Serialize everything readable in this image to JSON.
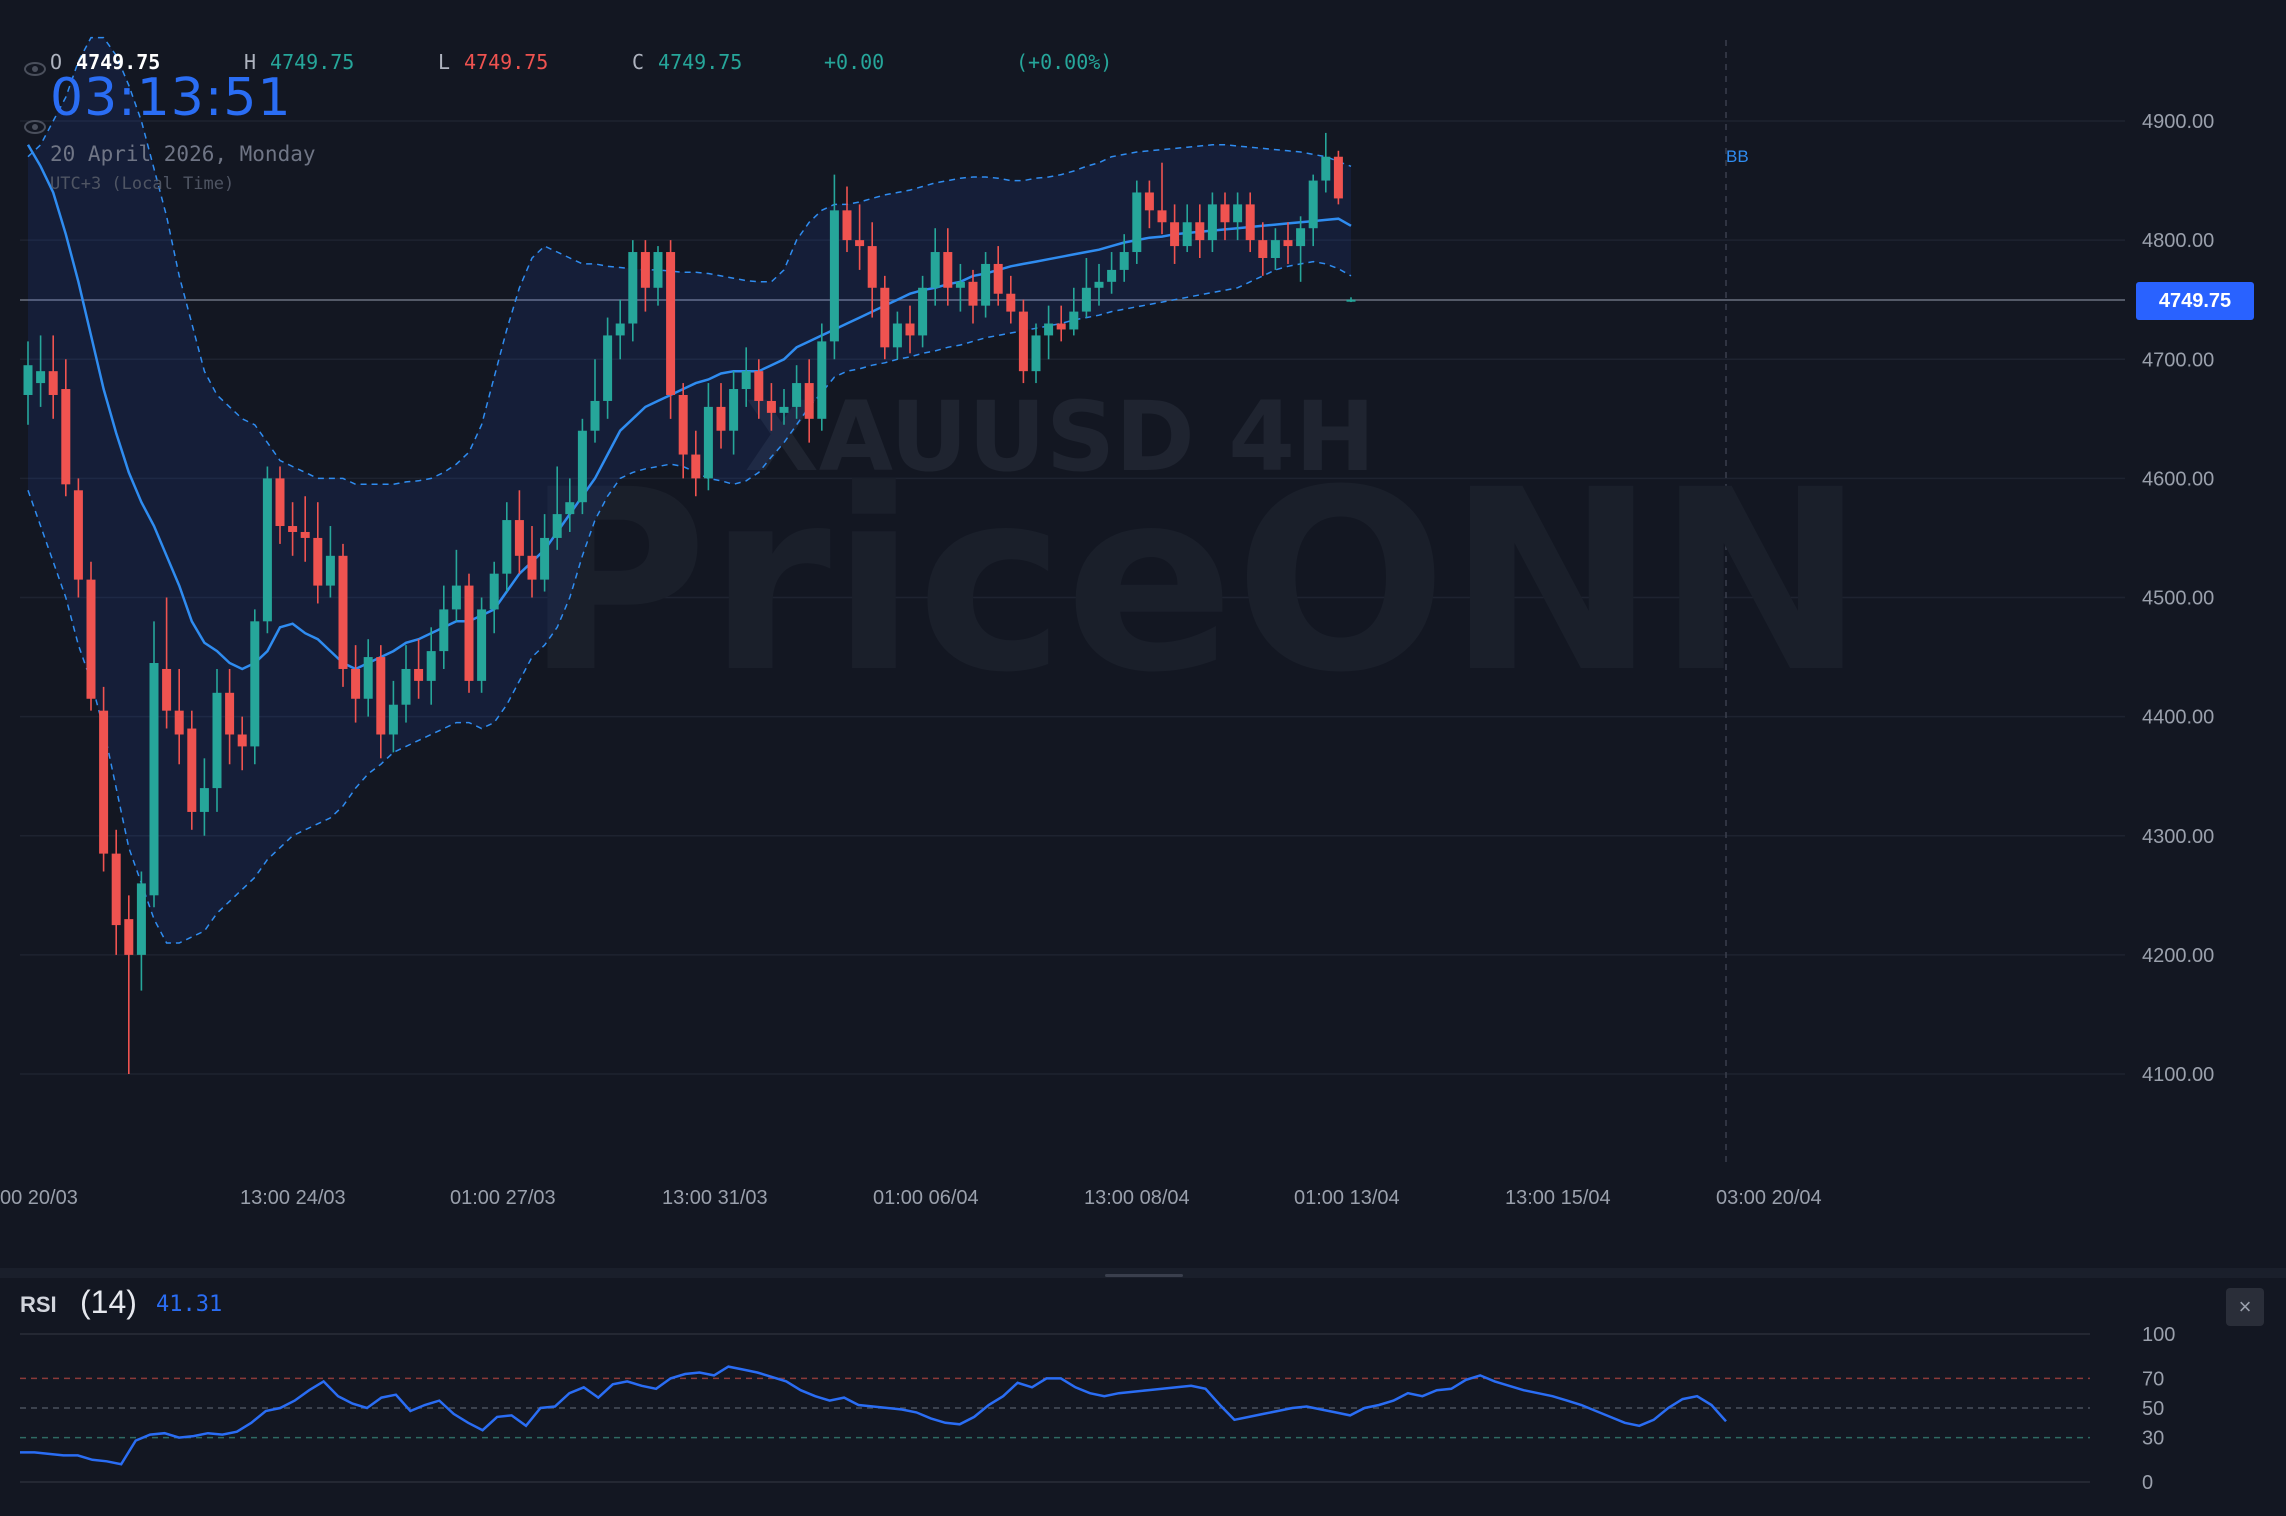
{
  "symbol_watermark": "XAUUSD 4H",
  "brand_watermark": "PriceONN",
  "ohlc": {
    "o_label": "O",
    "o": "4749.75",
    "h_label": "H",
    "h": "4749.75",
    "l_label": "L",
    "l": "4749.75",
    "c_label": "C",
    "c": "4749.75",
    "change": "+0.00",
    "change_pct": "(+0.00%)"
  },
  "clock": "03:13:51",
  "date": "20 April 2026, Monday",
  "timezone": "UTC+3 (Local Time)",
  "last_price_tag": "4749.75",
  "indicator_label": "BB",
  "rsi": {
    "title": "RSI",
    "length": "(14)",
    "value": "41.31"
  },
  "close_icon": "×",
  "colors": {
    "up": "#26a69a",
    "down": "#ef5350",
    "bb": "#2f8cf0",
    "rsi": "#2a6df4",
    "background": "#131722"
  },
  "chart_data": {
    "type": "candlestick",
    "ylim": [
      4020,
      4960
    ],
    "y_ticks": [
      "4100.00",
      "4200.00",
      "4300.00",
      "4400.00",
      "4500.00",
      "4600.00",
      "4700.00",
      "4800.00",
      "4900.00"
    ],
    "x_ticks": [
      "00 20/03",
      "13:00 24/03",
      "01:00 27/03",
      "13:00 31/03",
      "01:00 06/04",
      "13:00 08/04",
      "01:00 13/04",
      "13:00 15/04",
      "03:00 20/04"
    ],
    "last_price": 4749.75,
    "candles": [
      [
        4670,
        4695,
        4715,
        4645
      ],
      [
        4680,
        4690,
        4720,
        4660
      ],
      [
        4690,
        4670,
        4720,
        4650
      ],
      [
        4675,
        4595,
        4700,
        4585
      ],
      [
        4590,
        4515,
        4600,
        4500
      ],
      [
        4515,
        4415,
        4530,
        4405
      ],
      [
        4405,
        4285,
        4425,
        4270
      ],
      [
        4285,
        4225,
        4305,
        4200
      ],
      [
        4230,
        4200,
        4250,
        4100
      ],
      [
        4200,
        4260,
        4270,
        4170
      ],
      [
        4250,
        4445,
        4480,
        4240
      ],
      [
        4440,
        4405,
        4500,
        4390
      ],
      [
        4405,
        4385,
        4440,
        4360
      ],
      [
        4390,
        4320,
        4405,
        4305
      ],
      [
        4320,
        4340,
        4365,
        4300
      ],
      [
        4340,
        4420,
        4440,
        4320
      ],
      [
        4420,
        4385,
        4440,
        4360
      ],
      [
        4385,
        4375,
        4400,
        4355
      ],
      [
        4375,
        4480,
        4490,
        4360
      ],
      [
        4480,
        4600,
        4610,
        4470
      ],
      [
        4600,
        4560,
        4610,
        4545
      ],
      [
        4560,
        4555,
        4580,
        4535
      ],
      [
        4555,
        4550,
        4585,
        4530
      ],
      [
        4550,
        4510,
        4580,
        4495
      ],
      [
        4510,
        4535,
        4560,
        4500
      ],
      [
        4535,
        4440,
        4545,
        4425
      ],
      [
        4440,
        4415,
        4460,
        4395
      ],
      [
        4415,
        4450,
        4465,
        4400
      ],
      [
        4450,
        4385,
        4460,
        4365
      ],
      [
        4385,
        4410,
        4430,
        4370
      ],
      [
        4410,
        4440,
        4460,
        4395
      ],
      [
        4440,
        4430,
        4465,
        4415
      ],
      [
        4430,
        4455,
        4475,
        4410
      ],
      [
        4455,
        4490,
        4510,
        4440
      ],
      [
        4490,
        4510,
        4540,
        4480
      ],
      [
        4510,
        4430,
        4520,
        4420
      ],
      [
        4430,
        4490,
        4500,
        4420
      ],
      [
        4490,
        4520,
        4530,
        4470
      ],
      [
        4520,
        4565,
        4580,
        4505
      ],
      [
        4565,
        4535,
        4590,
        4520
      ],
      [
        4535,
        4515,
        4560,
        4500
      ],
      [
        4515,
        4550,
        4570,
        4505
      ],
      [
        4550,
        4570,
        4610,
        4540
      ],
      [
        4570,
        4580,
        4600,
        4555
      ],
      [
        4580,
        4640,
        4650,
        4570
      ],
      [
        4640,
        4665,
        4700,
        4630
      ],
      [
        4665,
        4720,
        4735,
        4650
      ],
      [
        4720,
        4730,
        4750,
        4700
      ],
      [
        4730,
        4790,
        4800,
        4715
      ],
      [
        4790,
        4760,
        4800,
        4740
      ],
      [
        4760,
        4790,
        4795,
        4745
      ],
      [
        4790,
        4670,
        4800,
        4650
      ],
      [
        4670,
        4620,
        4680,
        4600
      ],
      [
        4620,
        4600,
        4640,
        4585
      ],
      [
        4600,
        4660,
        4680,
        4590
      ],
      [
        4660,
        4640,
        4680,
        4625
      ],
      [
        4640,
        4675,
        4690,
        4620
      ],
      [
        4675,
        4690,
        4710,
        4660
      ],
      [
        4690,
        4665,
        4700,
        4650
      ],
      [
        4665,
        4655,
        4680,
        4640
      ],
      [
        4655,
        4660,
        4675,
        4645
      ],
      [
        4660,
        4680,
        4695,
        4650
      ],
      [
        4680,
        4650,
        4700,
        4630
      ],
      [
        4650,
        4715,
        4730,
        4640
      ],
      [
        4715,
        4825,
        4855,
        4700
      ],
      [
        4825,
        4800,
        4845,
        4790
      ],
      [
        4800,
        4795,
        4830,
        4775
      ],
      [
        4795,
        4760,
        4815,
        4735
      ],
      [
        4760,
        4710,
        4770,
        4700
      ],
      [
        4710,
        4730,
        4740,
        4700
      ],
      [
        4730,
        4720,
        4745,
        4705
      ],
      [
        4720,
        4760,
        4770,
        4710
      ],
      [
        4760,
        4790,
        4810,
        4745
      ],
      [
        4790,
        4760,
        4810,
        4745
      ],
      [
        4760,
        4765,
        4780,
        4740
      ],
      [
        4765,
        4745,
        4775,
        4730
      ],
      [
        4745,
        4780,
        4790,
        4735
      ],
      [
        4780,
        4755,
        4795,
        4745
      ],
      [
        4755,
        4740,
        4770,
        4730
      ],
      [
        4740,
        4690,
        4750,
        4680
      ],
      [
        4690,
        4720,
        4730,
        4680
      ],
      [
        4720,
        4730,
        4745,
        4700
      ],
      [
        4730,
        4725,
        4745,
        4715
      ],
      [
        4725,
        4740,
        4760,
        4720
      ],
      [
        4740,
        4760,
        4785,
        4735
      ],
      [
        4760,
        4765,
        4780,
        4745
      ],
      [
        4765,
        4775,
        4790,
        4755
      ],
      [
        4775,
        4790,
        4805,
        4765
      ],
      [
        4790,
        4840,
        4850,
        4780
      ],
      [
        4840,
        4825,
        4850,
        4810
      ],
      [
        4825,
        4815,
        4865,
        4805
      ],
      [
        4815,
        4795,
        4830,
        4780
      ],
      [
        4795,
        4815,
        4830,
        4790
      ],
      [
        4815,
        4800,
        4830,
        4785
      ],
      [
        4800,
        4830,
        4840,
        4790
      ],
      [
        4830,
        4815,
        4840,
        4800
      ],
      [
        4815,
        4830,
        4840,
        4800
      ],
      [
        4830,
        4800,
        4840,
        4790
      ],
      [
        4800,
        4785,
        4815,
        4770
      ],
      [
        4785,
        4800,
        4810,
        4775
      ],
      [
        4800,
        4795,
        4815,
        4780
      ],
      [
        4795,
        4810,
        4820,
        4765
      ],
      [
        4810,
        4850,
        4855,
        4795
      ],
      [
        4850,
        4870,
        4890,
        4840
      ],
      [
        4870,
        4835,
        4875,
        4830
      ],
      [
        4750,
        4750,
        4752,
        4748
      ]
    ],
    "bb_mid": [
      4880,
      4862,
      4840,
      4805,
      4765,
      4720,
      4675,
      4638,
      4605,
      4580,
      4560,
      4535,
      4510,
      4480,
      4462,
      4455,
      4445,
      4440,
      4445,
      4455,
      4475,
      4478,
      4470,
      4465,
      4455,
      4445,
      4440,
      4445,
      4450,
      4455,
      4462,
      4465,
      4470,
      4475,
      4480,
      4480,
      4485,
      4490,
      4505,
      4520,
      4530,
      4540,
      4555,
      4570,
      4585,
      4600,
      4620,
      4640,
      4650,
      4660,
      4665,
      4670,
      4675,
      4680,
      4683,
      4688,
      4690,
      4690,
      4690,
      4695,
      4700,
      4710,
      4715,
      4720,
      4725,
      4730,
      4735,
      4740,
      4745,
      4750,
      4755,
      4758,
      4760,
      4763,
      4765,
      4770,
      4772,
      4775,
      4778,
      4780,
      4782,
      4784,
      4786,
      4788,
      4790,
      4792,
      4795,
      4798,
      4800,
      4802,
      4803,
      4805,
      4806,
      4807,
      4808,
      4809,
      4810,
      4811,
      4812,
      4813,
      4814,
      4815,
      4816,
      4817,
      4818,
      4812
    ],
    "bb_upper": [
      4870,
      4880,
      4900,
      4920,
      4950,
      4970,
      4970,
      4955,
      4930,
      4900,
      4860,
      4820,
      4770,
      4730,
      4690,
      4670,
      4660,
      4650,
      4645,
      4630,
      4615,
      4610,
      4605,
      4600,
      4600,
      4600,
      4595,
      4595,
      4595,
      4595,
      4597,
      4598,
      4600,
      4605,
      4612,
      4622,
      4645,
      4685,
      4725,
      4760,
      4785,
      4795,
      4790,
      4785,
      4780,
      4780,
      4778,
      4777,
      4776,
      4775,
      4775,
      4774,
      4773,
      4773,
      4772,
      4770,
      4768,
      4766,
      4765,
      4765,
      4775,
      4800,
      4815,
      4825,
      4830,
      4830,
      4832,
      4835,
      4838,
      4840,
      4842,
      4845,
      4848,
      4850,
      4852,
      4853,
      4853,
      4852,
      4850,
      4850,
      4852,
      4853,
      4855,
      4858,
      4862,
      4865,
      4870,
      4872,
      4874,
      4875,
      4876,
      4877,
      4878,
      4879,
      4880,
      4880,
      4879,
      4878,
      4877,
      4876,
      4875,
      4874,
      4872,
      4870,
      4866,
      4862
    ],
    "bb_lower": [
      4590,
      4560,
      4530,
      4500,
      4460,
      4430,
      4390,
      4340,
      4290,
      4260,
      4230,
      4210,
      4210,
      4215,
      4220,
      4235,
      4245,
      4255,
      4265,
      4280,
      4290,
      4300,
      4305,
      4310,
      4315,
      4325,
      4340,
      4352,
      4360,
      4370,
      4375,
      4380,
      4385,
      4390,
      4395,
      4395,
      4390,
      4395,
      4410,
      4430,
      4450,
      4460,
      4475,
      4500,
      4535,
      4565,
      4585,
      4600,
      4605,
      4608,
      4610,
      4612,
      4610,
      4605,
      4600,
      4598,
      4595,
      4598,
      4605,
      4618,
      4630,
      4645,
      4660,
      4672,
      4685,
      4690,
      4692,
      4695,
      4697,
      4700,
      4702,
      4705,
      4707,
      4710,
      4712,
      4715,
      4718,
      4720,
      4722,
      4724,
      4726,
      4728,
      4730,
      4733,
      4735,
      4737,
      4740,
      4742,
      4744,
      4746,
      4748,
      4750,
      4752,
      4754,
      4756,
      4758,
      4760,
      4765,
      4770,
      4775,
      4778,
      4780,
      4782,
      4780,
      4776,
      4770
    ],
    "rsi": {
      "ylim": [
        0,
        100
      ],
      "ticks": [
        100,
        70,
        50,
        30,
        0
      ],
      "levels": [
        70,
        50,
        30
      ],
      "values": [
        20,
        20,
        19,
        18,
        18,
        15,
        14,
        12,
        28,
        32,
        33,
        30,
        31,
        33,
        32,
        34,
        40,
        48,
        50,
        55,
        62,
        68,
        58,
        53,
        50,
        57,
        59,
        48,
        52,
        55,
        46,
        40,
        35,
        44,
        45,
        38,
        50,
        51,
        60,
        64,
        57,
        66,
        68,
        65,
        63,
        70,
        73,
        74,
        72,
        78,
        76,
        74,
        71,
        68,
        62,
        58,
        55,
        57,
        52,
        51,
        50,
        49,
        47,
        43,
        40,
        39,
        44,
        52,
        58,
        67,
        64,
        70,
        70,
        64,
        60,
        58,
        60,
        61,
        62,
        63,
        64,
        65,
        63,
        52,
        42,
        44,
        46,
        48,
        50,
        51,
        49,
        47,
        45,
        50,
        52,
        55,
        60,
        58,
        62,
        63,
        69,
        72,
        68,
        65,
        62,
        60,
        58,
        55,
        52,
        48,
        44,
        40,
        38,
        42,
        50,
        56,
        58,
        52,
        41
      ]
    }
  }
}
